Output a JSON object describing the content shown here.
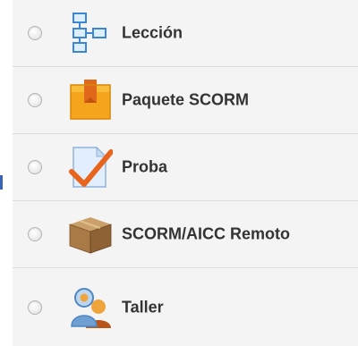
{
  "activity_chooser": {
    "options": [
      {
        "label": "Lección",
        "icon": "lesson-flowchart-icon",
        "selected": false
      },
      {
        "label": "Paquete SCORM",
        "icon": "scorm-package-icon",
        "selected": false
      },
      {
        "label": "Proba",
        "icon": "quiz-check-icon",
        "selected": false
      },
      {
        "label": "SCORM/AICC Remoto",
        "icon": "remote-box-icon",
        "selected": false
      },
      {
        "label": "Taller",
        "icon": "workshop-people-icon",
        "selected": false
      }
    ]
  },
  "colors": {
    "panel_background": "#f4f4f4",
    "label_text": "#333333",
    "divider": "#dcdcdc",
    "accent_mark": "#3a64b5"
  }
}
